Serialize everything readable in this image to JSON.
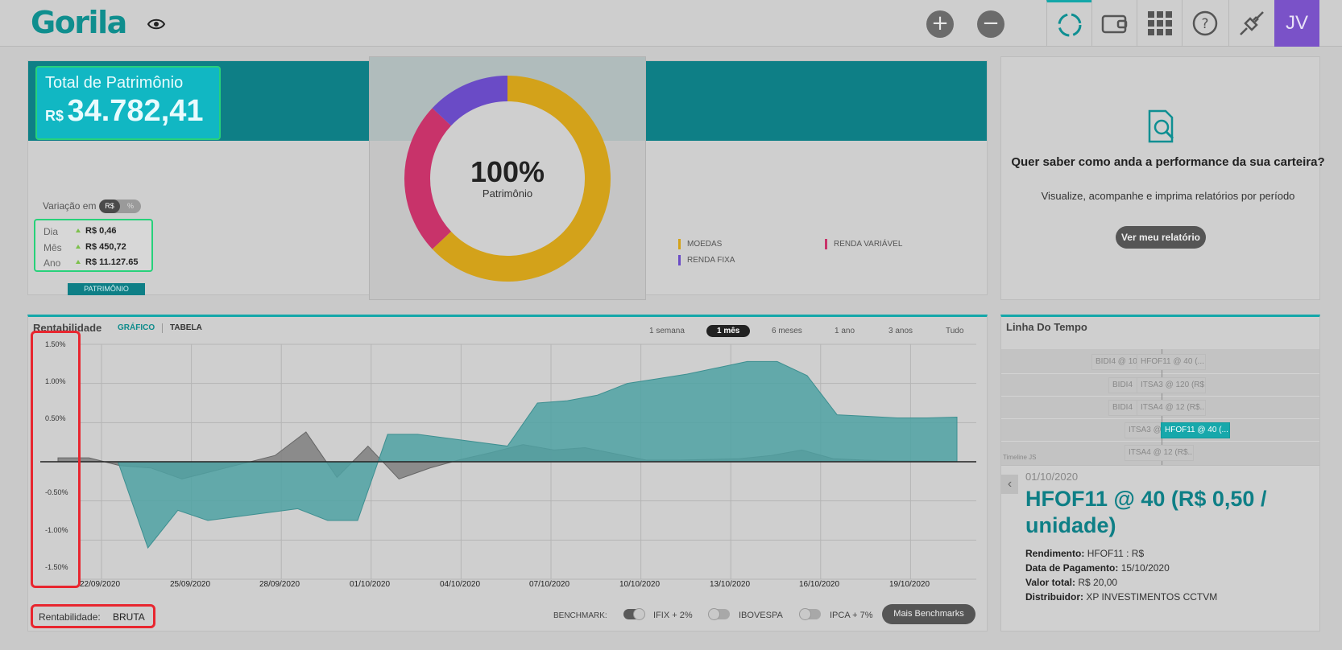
{
  "header": {
    "logo_text": "Gorila",
    "avatar_initials": "JV",
    "icons": [
      "eye-icon",
      "plus-icon",
      "minus-icon",
      "loading-icon",
      "wallet-icon",
      "grid-icon",
      "help-icon",
      "plug-icon"
    ]
  },
  "patrimonio": {
    "total_label": "Total de Patrimônio",
    "currency": "R$",
    "total_value": "34.782,41",
    "variation_label": "Variação em",
    "toggle_options": [
      "R$",
      "%"
    ],
    "rows": [
      {
        "label": "Dia",
        "value": "R$ 0,46"
      },
      {
        "label": "Mês",
        "value": "R$ 450,72"
      },
      {
        "label": "Ano",
        "value": "R$ 11.127.65"
      }
    ],
    "tab_label": "PATRIMÔNIO"
  },
  "donut": {
    "center_value": "100%",
    "center_label": "Patrimônio",
    "legend": [
      {
        "name": "MOEDAS",
        "color": "#d3a21a"
      },
      {
        "name": "RENDA VARIÁVEL",
        "color": "#c8336a"
      },
      {
        "name": "RENDA FIXA",
        "color": "#6a4bc6"
      }
    ],
    "slices": [
      {
        "name": "MOEDAS",
        "fraction": 0.63,
        "color": "#d3a21a"
      },
      {
        "name": "RENDA VARIÁVEL",
        "fraction": 0.24,
        "color": "#c8336a"
      },
      {
        "name": "RENDA FIXA",
        "fraction": 0.13,
        "color": "#6a4bc6"
      }
    ]
  },
  "performance": {
    "question": "Quer saber como anda a performance da sua carteira?",
    "description": "Visualize, acompanhe e imprima relatórios por período",
    "button": "Ver meu relatório"
  },
  "rentabilidade": {
    "title": "Rentabilidade",
    "tabs": [
      "GRÁFICO",
      "TABELA"
    ],
    "ranges": [
      "1 semana",
      "1 mês",
      "6 meses",
      "1 ano",
      "3 anos",
      "Tudo"
    ],
    "active_range": "1 mês",
    "footer_label": "Rentabilidade:",
    "footer_value": "BRUTA",
    "benchmark_label": "BENCHMARK:",
    "benchmarks": [
      {
        "name": "IFIX + 2%",
        "on": true
      },
      {
        "name": "IBOVESPA",
        "on": false
      },
      {
        "name": "IPCA + 7%",
        "on": false
      }
    ],
    "more_button": "Mais Benchmarks"
  },
  "chart_data": {
    "type": "area",
    "y_tick_labels": [
      "1.50%",
      "1.00%",
      "0.50%",
      "-0.50%",
      "-1.00%",
      "-1.50%"
    ],
    "x_tick_labels": [
      "22/09/2020",
      "25/09/2020",
      "28/09/2020",
      "01/10/2020",
      "04/10/2020",
      "07/10/2020",
      "10/10/2020",
      "13/10/2020",
      "16/10/2020",
      "19/10/2020"
    ],
    "ylim": [
      -1.5,
      1.5
    ],
    "series": [
      {
        "values": [
          0.05,
          0.05,
          -0.05,
          -0.08,
          -0.22,
          -0.12,
          -0.02,
          0.08,
          0.38,
          -0.2,
          0.2,
          -0.22,
          -0.08,
          0.03,
          0.12,
          0.22,
          0.15,
          0.18,
          0.1,
          0.02,
          0.02,
          0.03,
          0.04,
          0.08,
          0.15,
          0.04,
          0.02,
          0.01,
          0.01,
          0.0
        ],
        "fill": "#7f7f7f"
      },
      {
        "values": [
          0.0,
          0.0,
          0.0,
          -1.1,
          -0.62,
          -0.75,
          -0.7,
          -0.65,
          -0.6,
          -0.75,
          -0.75,
          0.35,
          0.35,
          0.3,
          0.25,
          0.2,
          0.75,
          0.78,
          0.85,
          1.0,
          1.06,
          1.12,
          1.2,
          1.28,
          1.28,
          1.1,
          0.6,
          0.58,
          0.56,
          0.56,
          0.57
        ],
        "fill": "#4fa2a3"
      }
    ]
  },
  "timeline": {
    "title": "Linha Do Tempo",
    "items": [
      {
        "label": "BIDI4 @ 10"
      },
      {
        "label": "HFOF11 @ 40 (..."
      },
      {
        "label": "BIDI4"
      },
      {
        "label": "ITSA3 @ 120 (R$..."
      },
      {
        "label": "BIDI4"
      },
      {
        "label": "ITSA4 @ 12 (R$..."
      },
      {
        "label": "ITSA3 @"
      },
      {
        "label": "HFOF11 @ 40 (..."
      },
      {
        "label": "ITSA4 @ 12 (R$..."
      }
    ],
    "watermark": "Timeline JS",
    "detail": {
      "date": "01/10/2020",
      "title": "HFOF11 @ 40 (R$ 0,50 / unidade)",
      "rows": [
        {
          "label": "Rendimento:",
          "value": "HFOF11 : R$"
        },
        {
          "label": "Data de Pagamento:",
          "value": "15/10/2020"
        },
        {
          "label": "Valor total:",
          "value": "R$ 20,00"
        },
        {
          "label": "Distribuidor:",
          "value": "XP INVESTIMENTOS CCTVM"
        }
      ]
    }
  }
}
